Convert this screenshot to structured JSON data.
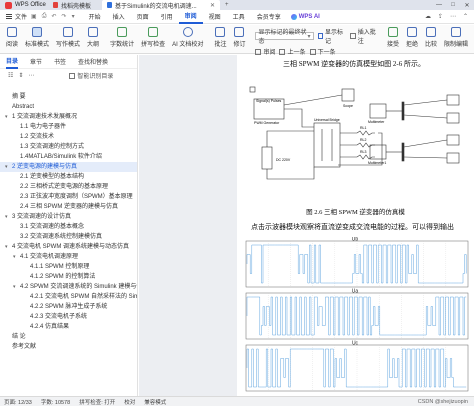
{
  "titlebar": {
    "app_name": "WPS Office",
    "tabs": [
      {
        "label": "找稻壳模板"
      },
      {
        "label": "基于Simulink的交流电机调速..."
      }
    ],
    "controls": [
      "—",
      "□",
      "✕"
    ]
  },
  "menubar": {
    "file_label": "文件",
    "items": [
      "开始",
      "插入",
      "页面",
      "引用",
      "审阅",
      "视图",
      "工具",
      "会员专享"
    ],
    "active": "视图",
    "ai_label": "WPS AI"
  },
  "ribbon": {
    "buttons": [
      {
        "label": "阅读",
        "icon": "read-icon"
      },
      {
        "label": "标准模式",
        "icon": "standard-mode-icon"
      },
      {
        "label": "写作模式",
        "icon": "write-mode-icon"
      },
      {
        "label": "大纲",
        "icon": "outline-icon"
      },
      {
        "label": "字数统计",
        "icon": "wordcount-icon"
      },
      {
        "label": "拼写检查",
        "icon": "spellcheck-icon"
      },
      {
        "label": "AI 文档校对",
        "icon": "ai-proofread-icon"
      },
      {
        "label": "批注",
        "icon": "comment-icon"
      },
      {
        "label": "修订",
        "icon": "revision-icon"
      }
    ],
    "revision_select": "显示标记的最终状态",
    "small_buttons": [
      "显示标记",
      "审阅",
      "插入批注",
      "上一条",
      "下一条"
    ],
    "right_buttons": [
      "接受",
      "拒绝",
      "比较",
      "限制编辑"
    ]
  },
  "nav": {
    "tabs": [
      "目录",
      "章节",
      "书签",
      "查找和替换"
    ],
    "active_tab": "目录",
    "tools": [
      "smart-toc-icon",
      "expand-icon",
      "more-icon"
    ],
    "check_label": "智能识别目录",
    "toc": [
      {
        "label": "摘 要",
        "level": 1,
        "expand": false
      },
      {
        "label": "Abstract",
        "level": 1,
        "expand": false
      },
      {
        "label": "1 交流调速技术发展概况",
        "level": 1,
        "expand": true
      },
      {
        "label": "1.1 电力电子器件",
        "level": 2,
        "expand": false
      },
      {
        "label": "1.2 交流技术",
        "level": 2,
        "expand": false
      },
      {
        "label": "1.3 交流调速的控制方式",
        "level": 2,
        "expand": false
      },
      {
        "label": "1.4MATLAB/Simulink 软件介绍",
        "level": 2,
        "expand": false
      },
      {
        "label": "2 逆变电源的建模与仿真",
        "level": 1,
        "expand": true,
        "selected": true
      },
      {
        "label": "2.1 逆变模型的基本结构",
        "level": 2,
        "expand": false
      },
      {
        "label": "2.2 三相桥式逆变电源的基本原理",
        "level": 2,
        "expand": false
      },
      {
        "label": "2.3 正弦波冲宽度调制（SPWM）基本原理",
        "level": 2,
        "expand": false
      },
      {
        "label": "2.4 三相 SPWM 逆变器的建模与仿真",
        "level": 2,
        "expand": false
      },
      {
        "label": "3 交流调速的设计仿真",
        "level": 1,
        "expand": true
      },
      {
        "label": "3.1 交流调速的基本概念",
        "level": 2,
        "expand": false
      },
      {
        "label": "3.2 交流调速系统控制建模仿真",
        "level": 2,
        "expand": false
      },
      {
        "label": "4 交流电机 SPWM 调速系统建模与动态仿真",
        "level": 1,
        "expand": true
      },
      {
        "label": "4.1 交流电机调速原理",
        "level": 2,
        "expand": true
      },
      {
        "label": "4.1.1 SPWM 控制原理",
        "level": 3,
        "expand": false
      },
      {
        "label": "4.1.2 SPWM 的控制算法",
        "level": 3,
        "expand": false
      },
      {
        "label": "4.2 SPWM 交流调速系统的 Simulink 建模与仿真实验",
        "level": 2,
        "expand": true
      },
      {
        "label": "4.2.1 交流电机 SPWM 自然采样法的 Simulink ...",
        "level": 3,
        "expand": false
      },
      {
        "label": "4.2.2 SPWM 脉冲生成子系统",
        "level": 3,
        "expand": false
      },
      {
        "label": "4.2.3 交流电机子系统",
        "level": 3,
        "expand": false
      },
      {
        "label": "4.2.4 仿真结果",
        "level": 3,
        "expand": false
      },
      {
        "label": "结 论",
        "level": 1,
        "expand": false
      },
      {
        "label": "参考文献",
        "level": 1,
        "expand": false
      }
    ]
  },
  "document": {
    "intro_text": "三相 SPWM 逆变器的仿真模型如图 2-6 所示。",
    "figure_caption": "图 2.6  三相 SPWM 逆变器的仿真模",
    "para_text": "点击示波器模块观察将直流逆变成交流电能的过程。可以得到输出",
    "diagram_labels": {
      "pulses": "Discrete, Ts=5e-006 s.",
      "pulse_block": "Signal(s)  Pulses",
      "pwm_gen": "PWM Generator",
      "bridge": "Universal Bridge",
      "dc": "DC 220V",
      "scope": "Scope",
      "mm1": "Multimeter",
      "mm2": "Multimeter1",
      "rl1": "RL1",
      "rl2": "RL2",
      "rl3": "RL3"
    },
    "wave_labels": [
      "Ub",
      "Ua",
      "Uc"
    ]
  },
  "statusbar": {
    "page": "页面: 12/33",
    "words": "字数: 10578",
    "spell": "拼写检查: 打开",
    "proof": "校对",
    "compat": "兼容模式",
    "watermark": "CSDN @shejizuopin"
  },
  "colors": {
    "accent": "#1f5cd6",
    "wave": "#3a8fd8",
    "titlebar_bg": "#dfe3ec"
  }
}
